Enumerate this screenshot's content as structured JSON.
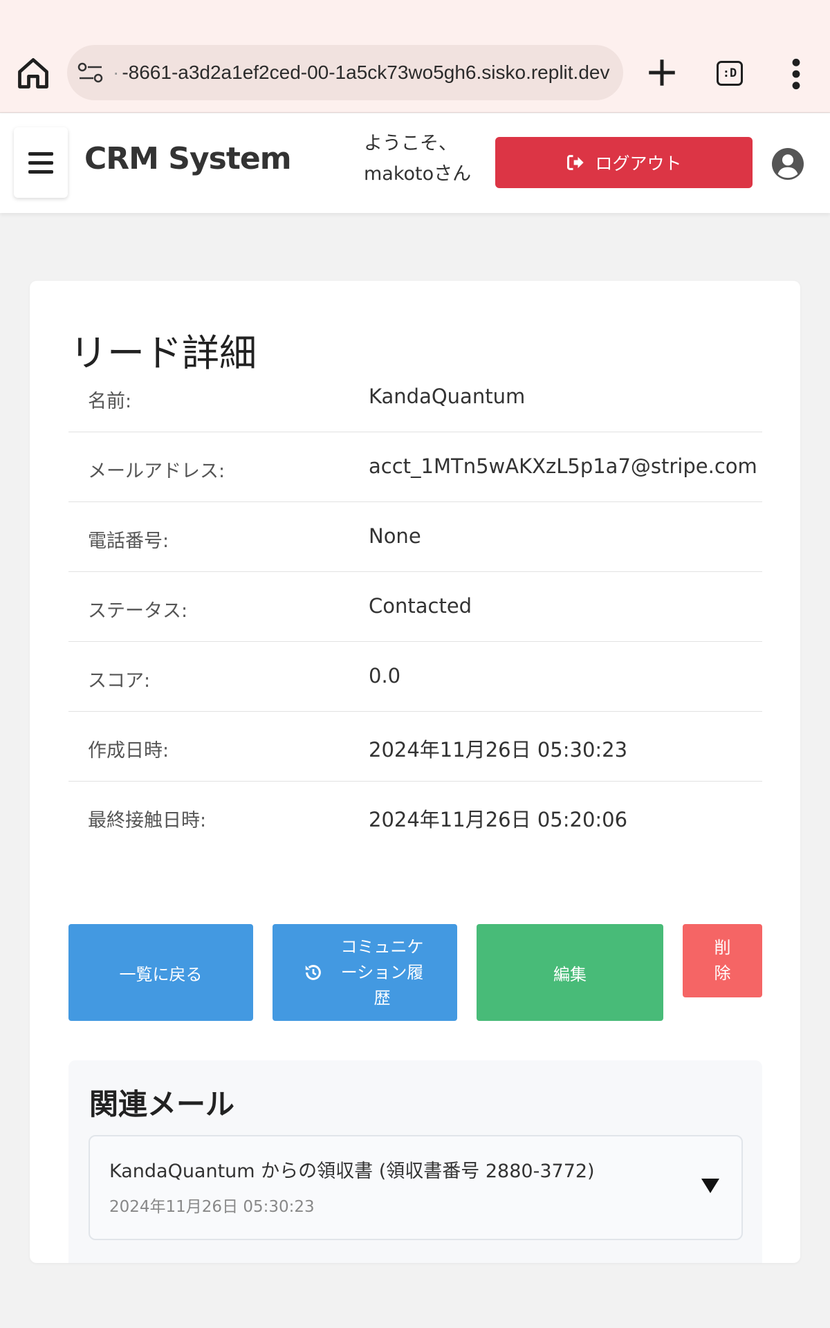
{
  "browser": {
    "url": "-8661-a3d2a1ef2ced-00-1a5ck73wo5gh6.sisko.replit.dev",
    "tabs_label": ":D"
  },
  "header": {
    "app_title": "CRM System",
    "welcome_line1": "ようこそ、",
    "welcome_line2": "makotoさん",
    "logout_label": "ログアウト",
    "logout_color": "#dc3545"
  },
  "lead": {
    "title": "リード詳細",
    "fields": [
      {
        "label": "名前:",
        "value": "KandaQuantum"
      },
      {
        "label": "メールアドレス:",
        "value": "acct_1MTn5wAKXzL5p1a7@stripe.com"
      },
      {
        "label": "電話番号:",
        "value": "None"
      },
      {
        "label": "ステータス:",
        "value": "Contacted"
      },
      {
        "label": "スコア:",
        "value": "0.0"
      },
      {
        "label": "作成日時:",
        "value": "2024年11月26日 05:30:23"
      },
      {
        "label": "最終接触日時:",
        "value": "2024年11月26日 05:20:06"
      }
    ]
  },
  "actions": {
    "back_label": "一覧に戻る",
    "history_label": "コミュニケーション履歴",
    "edit_label": "編集",
    "delete_label": "削除",
    "colors": {
      "back": "#4399e1",
      "history": "#4399e1",
      "edit": "#48bb78",
      "delete": "#f56565"
    }
  },
  "related_mail": {
    "title": "関連メール",
    "items": [
      {
        "subject": "KandaQuantum からの領収書 (領収書番号 2880-3772)",
        "date": "2024年11月26日 05:30:23"
      }
    ]
  }
}
